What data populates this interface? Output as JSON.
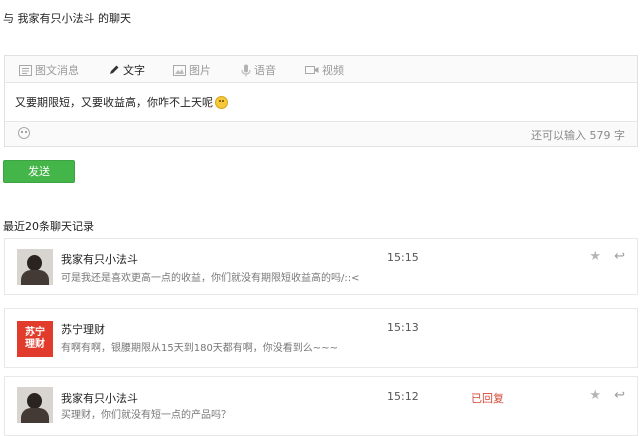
{
  "title": "与 我家有只小法斗 的聊天",
  "editor": {
    "tabs": [
      {
        "label": "图文消息",
        "icon": "article-icon"
      },
      {
        "label": "文字",
        "icon": "pen-icon"
      },
      {
        "label": "图片",
        "icon": "image-icon"
      },
      {
        "label": "语音",
        "icon": "mic-icon"
      },
      {
        "label": "视频",
        "icon": "video-icon"
      }
    ],
    "message": "又要期限短，又要收益高，你咋不上天呢",
    "remaining": "还可以输入 579 字"
  },
  "send_label": "发送",
  "history_title": "最近20条聊天记录",
  "records": [
    {
      "name": "我家有只小法斗",
      "content": "可是我还是喜欢更高一点的收益，你们就没有期限短收益高的吗/::<",
      "time": "15:15",
      "status": "",
      "avatar": "photo"
    },
    {
      "name": "苏宁理财",
      "content": "有啊有啊，银腰期限从15天到180天都有啊，你没看到么~~~",
      "time": "15:13",
      "status": "",
      "avatar": "logo",
      "avatar_text_1": "苏宁",
      "avatar_text_2": "理财"
    },
    {
      "name": "我家有只小法斗",
      "content": "买理财，你们就没有短一点的产品吗？",
      "time": "15:12",
      "status": "已回复",
      "avatar": "photo"
    }
  ]
}
